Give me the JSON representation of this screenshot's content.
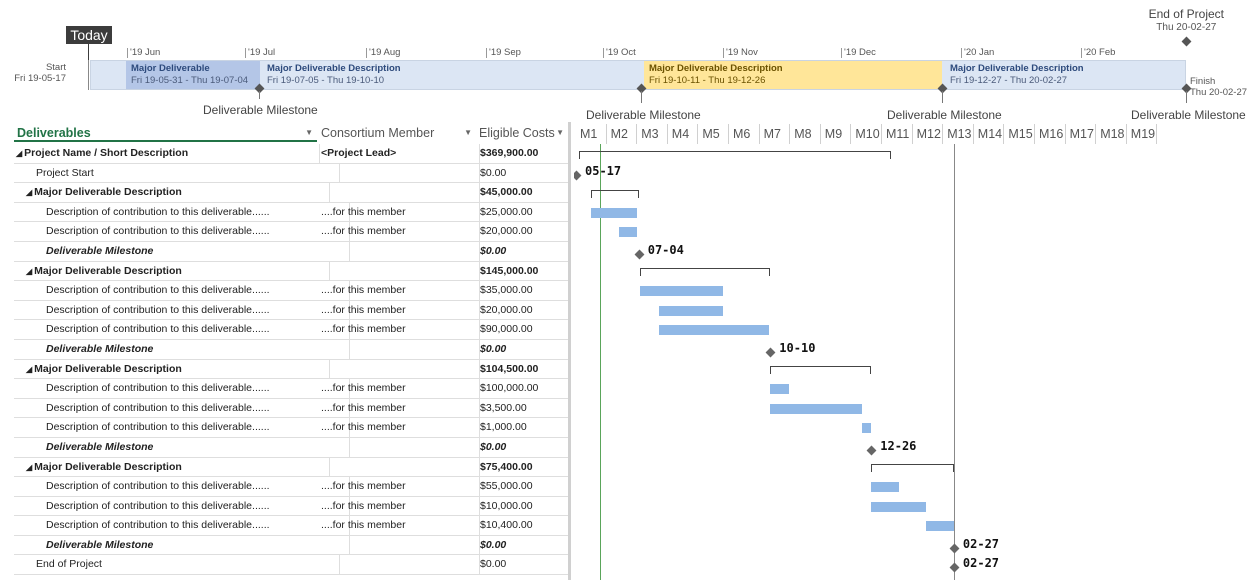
{
  "timeline": {
    "end_label": "End of Project",
    "end_date": "Thu 20-02-27",
    "today_label": "Today",
    "months": [
      "'19 Jun",
      "'19 Jul",
      "'19 Aug",
      "'19 Sep",
      "'19 Oct",
      "'19 Nov",
      "'19 Dec",
      "'20 Jan",
      "'20 Feb"
    ],
    "start_label": "Start",
    "start_date": "Fri 19-05-17",
    "finish_label": "Finish",
    "finish_date": "Thu 20-02-27",
    "segments": [
      {
        "title": "Major Deliverable",
        "range": "Fri 19-05-31 - Thu 19-07-04",
        "color": "#b4c6e7"
      },
      {
        "title": "Major Deliverable Description",
        "range": "Fri 19-07-05 - Thu 19-10-10",
        "color": "#dce6f4"
      },
      {
        "title": "Major Deliverable Description",
        "range": "Fri 19-10-11 - Thu 19-12-26",
        "color": "#ffe699"
      },
      {
        "title": "Major Deliverable Description",
        "range": "Fri 19-12-27 - Thu 20-02-27",
        "color": "#dce6f4"
      }
    ],
    "milestone_labels": [
      "Deliverable Milestone",
      "Deliverable Milestone",
      "Deliverable Milestone",
      "Deliverable Milestone"
    ]
  },
  "grid": {
    "headers": {
      "deliverables": "Deliverables",
      "member": "Consortium Member",
      "costs": "Eligible Costs"
    },
    "rows": [
      {
        "name": "Project Name / Short Description",
        "member": "<Project Lead>",
        "cost": "$369,900.00",
        "style": "summary",
        "indent": 0
      },
      {
        "name": "Project Start",
        "member": "",
        "cost": "$0.00",
        "style": "normal",
        "indent": 1
      },
      {
        "name": "Major Deliverable Description",
        "member": "",
        "cost": "$45,000.00",
        "style": "summary",
        "indent": 1
      },
      {
        "name": "Description of contribution to this deliverable......",
        "member": "....for this member",
        "cost": "$25,000.00",
        "style": "normal",
        "indent": 2
      },
      {
        "name": "Description of contribution to this deliverable......",
        "member": "....for this member",
        "cost": "$20,000.00",
        "style": "normal",
        "indent": 2
      },
      {
        "name": "Deliverable Milestone",
        "member": "",
        "cost": "$0.00",
        "style": "milestone",
        "indent": 2
      },
      {
        "name": "Major Deliverable Description",
        "member": "",
        "cost": "$145,000.00",
        "style": "summary",
        "indent": 1
      },
      {
        "name": "Description of contribution to this deliverable......",
        "member": "....for this member",
        "cost": "$35,000.00",
        "style": "normal",
        "indent": 2
      },
      {
        "name": "Description of contribution to this deliverable......",
        "member": "....for this member",
        "cost": "$20,000.00",
        "style": "normal",
        "indent": 2
      },
      {
        "name": "Description of contribution to this deliverable......",
        "member": "....for this member",
        "cost": "$90,000.00",
        "style": "normal",
        "indent": 2
      },
      {
        "name": "Deliverable Milestone",
        "member": "",
        "cost": "$0.00",
        "style": "milestone",
        "indent": 2
      },
      {
        "name": "Major Deliverable Description",
        "member": "",
        "cost": "$104,500.00",
        "style": "summary",
        "indent": 1
      },
      {
        "name": "Description of contribution to this deliverable......",
        "member": "....for this member",
        "cost": "$100,000.00",
        "style": "normal",
        "indent": 2
      },
      {
        "name": "Description of contribution to this deliverable......",
        "member": "....for this member",
        "cost": "$3,500.00",
        "style": "normal",
        "indent": 2
      },
      {
        "name": "Description of contribution to this deliverable......",
        "member": "....for this member",
        "cost": "$1,000.00",
        "style": "normal",
        "indent": 2
      },
      {
        "name": "Deliverable Milestone",
        "member": "",
        "cost": "$0.00",
        "style": "milestone",
        "indent": 2
      },
      {
        "name": "Major Deliverable Description",
        "member": "",
        "cost": "$75,400.00",
        "style": "summary",
        "indent": 1
      },
      {
        "name": "Description of contribution to this deliverable......",
        "member": "....for this member",
        "cost": "$55,000.00",
        "style": "normal",
        "indent": 2
      },
      {
        "name": "Description of contribution to this deliverable......",
        "member": "....for this member",
        "cost": "$10,000.00",
        "style": "normal",
        "indent": 2
      },
      {
        "name": "Description of contribution to this deliverable......",
        "member": "....for this member",
        "cost": "$10,400.00",
        "style": "normal",
        "indent": 2
      },
      {
        "name": "Deliverable Milestone",
        "member": "",
        "cost": "$0.00",
        "style": "milestone",
        "indent": 2
      },
      {
        "name": "End of Project",
        "member": "",
        "cost": "$0.00",
        "style": "normal",
        "indent": 1
      }
    ]
  },
  "gantt": {
    "months": [
      "M1",
      "M2",
      "M3",
      "M4",
      "M5",
      "M6",
      "M7",
      "M8",
      "M9",
      "M10",
      "M11",
      "M12",
      "M13",
      "M14",
      "M15",
      "M16",
      "M17",
      "M18",
      "M19"
    ],
    "rows": [
      {
        "kind": "summary",
        "start": 0.1,
        "end": 10.3
      },
      {
        "kind": "milestone",
        "at": 0.0,
        "label": "05-17"
      },
      {
        "kind": "summary",
        "start": 0.5,
        "end": 2.05
      },
      {
        "kind": "task",
        "start": 0.5,
        "end": 2.0
      },
      {
        "kind": "task",
        "start": 1.4,
        "end": 2.0
      },
      {
        "kind": "milestone",
        "at": 2.05,
        "label": "07-04"
      },
      {
        "kind": "summary",
        "start": 2.1,
        "end": 6.35
      },
      {
        "kind": "task",
        "start": 2.1,
        "end": 4.8
      },
      {
        "kind": "task",
        "start": 2.7,
        "end": 4.8
      },
      {
        "kind": "task",
        "start": 2.7,
        "end": 6.3
      },
      {
        "kind": "milestone",
        "at": 6.35,
        "label": "10-10"
      },
      {
        "kind": "summary",
        "start": 6.35,
        "end": 9.65
      },
      {
        "kind": "task",
        "start": 6.35,
        "end": 6.95
      },
      {
        "kind": "task",
        "start": 6.35,
        "end": 9.35
      },
      {
        "kind": "task",
        "start": 9.35,
        "end": 9.65
      },
      {
        "kind": "milestone",
        "at": 9.65,
        "label": "12-26"
      },
      {
        "kind": "summary",
        "start": 9.65,
        "end": 12.35
      },
      {
        "kind": "task",
        "start": 9.65,
        "end": 10.55
      },
      {
        "kind": "task",
        "start": 9.65,
        "end": 11.45
      },
      {
        "kind": "task",
        "start": 11.45,
        "end": 12.35
      },
      {
        "kind": "milestone",
        "at": 12.35,
        "label": "02-27"
      },
      {
        "kind": "milestone",
        "at": 12.35,
        "label": "02-27"
      }
    ]
  },
  "colors": {
    "accent": "#217346",
    "task_bar": "#90b8e6",
    "highlight": "#ffe699"
  }
}
